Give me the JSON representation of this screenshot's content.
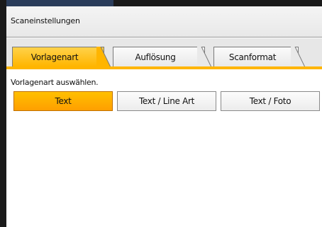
{
  "window": {
    "title": "Scaneinstellungen"
  },
  "tabs": [
    {
      "label": "Vorlagenart",
      "active": true
    },
    {
      "label": "Auflösung",
      "active": false
    },
    {
      "label": "Scanformat",
      "active": false
    }
  ],
  "content": {
    "prompt": "Vorlagenart auswählen.",
    "options": [
      {
        "label": "Text",
        "selected": true
      },
      {
        "label": "Text / Line Art",
        "selected": false
      },
      {
        "label": "Text / Foto",
        "selected": false
      }
    ]
  },
  "colors": {
    "accent": "#ffb500",
    "selected_option": "#ffa800",
    "bezel": "#1a1a1a"
  }
}
